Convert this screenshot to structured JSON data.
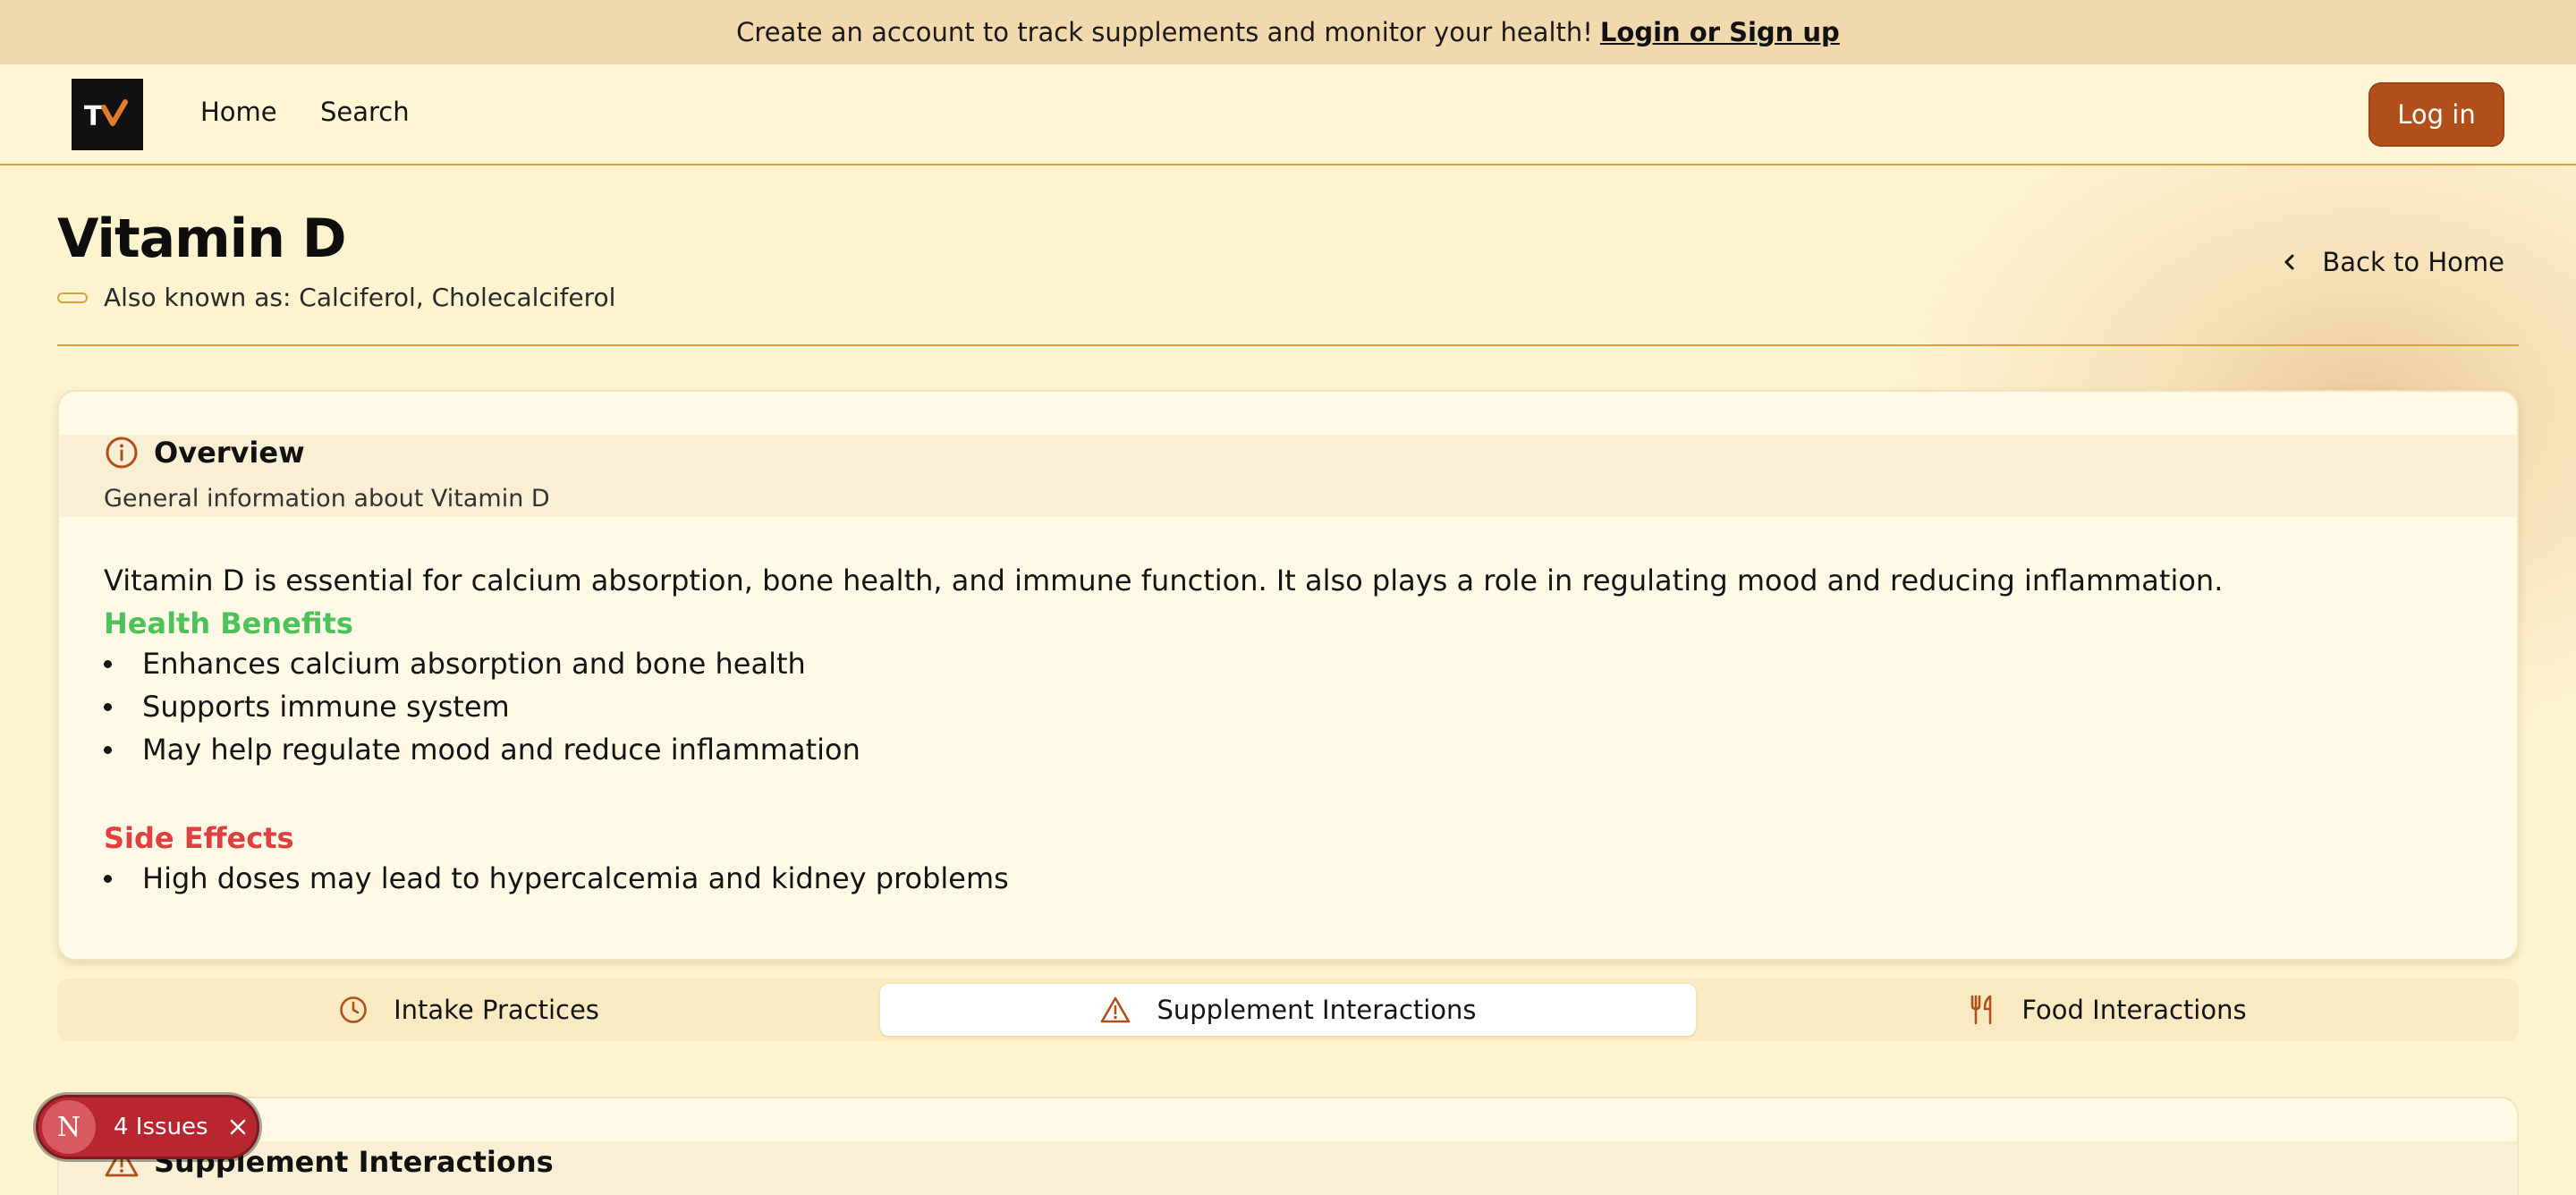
{
  "banner": {
    "text": "Create an account to track supplements and monitor your health!",
    "link": "Login or Sign up"
  },
  "nav": {
    "logo_text": "TV",
    "links": [
      "Home",
      "Search"
    ],
    "login_label": "Log in"
  },
  "page": {
    "title": "Vitamin D",
    "aka": "Also known as: Calciferol, Cholecalciferol",
    "back_label": "Back to Home"
  },
  "overview": {
    "title": "Overview",
    "subtitle": "General information about Vitamin D",
    "description": "Vitamin D is essential for calcium absorption, bone health, and immune function. It also plays a role in regulating mood and reducing inflammation.",
    "benefits_heading": "Health Benefits",
    "benefits": [
      "Enhances calcium absorption and bone health",
      "Supports immune system",
      "May help regulate mood and reduce inflammation"
    ],
    "side_effects_heading": "Side Effects",
    "side_effects": [
      "High doses may lead to hypercalcemia and kidney problems"
    ]
  },
  "tabs": [
    {
      "label": "Intake Practices",
      "icon": "clock-icon"
    },
    {
      "label": "Supplement Interactions",
      "icon": "warning-icon",
      "active": true
    },
    {
      "label": "Food Interactions",
      "icon": "utensils-icon"
    }
  ],
  "interactions_card": {
    "title": "Supplement Interactions"
  },
  "issues_badge": {
    "logo": "N",
    "label": "4 Issues"
  },
  "colors": {
    "accent": "#b2501c",
    "benefits": "#4cc35a",
    "side_effects": "#df3f3f",
    "background": "#fdf3cf"
  }
}
